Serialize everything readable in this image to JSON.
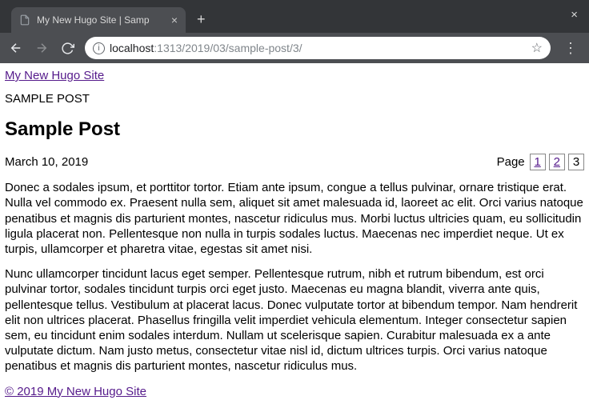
{
  "browser": {
    "tab_title": "My New Hugo Site | Samp",
    "url_host": "localhost",
    "url_rest": ":1313/2019/03/sample-post/3/"
  },
  "site": {
    "title_link": "My New Hugo Site",
    "breadcrumb": "SAMPLE POST"
  },
  "post": {
    "title": "Sample Post",
    "date": "March 10, 2019",
    "pagination": {
      "label": "Page",
      "pages": [
        {
          "n": "1",
          "current": false
        },
        {
          "n": "2",
          "current": false
        },
        {
          "n": "3",
          "current": true
        }
      ]
    },
    "paragraphs": [
      "Donec a sodales ipsum, et porttitor tortor. Etiam ante ipsum, congue a tellus pulvinar, ornare tristique erat. Nulla vel commodo ex. Praesent nulla sem, aliquet sit amet malesuada id, laoreet ac elit. Orci varius natoque penatibus et magnis dis parturient montes, nascetur ridiculus mus. Morbi luctus ultricies quam, eu sollicitudin ligula placerat non. Pellentesque non nulla in turpis sodales luctus. Maecenas nec imperdiet neque. Ut ex turpis, ullamcorper et pharetra vitae, egestas sit amet nisi.",
      "Nunc ullamcorper tincidunt lacus eget semper. Pellentesque rutrum, nibh et rutrum bibendum, est orci pulvinar tortor, sodales tincidunt turpis orci eget justo. Maecenas eu magna blandit, viverra ante quis, pellentesque tellus. Vestibulum at placerat lacus. Donec vulputate tortor at bibendum tempor. Nam hendrerit elit non ultrices placerat. Phasellus fringilla velit imperdiet vehicula elementum. Integer consectetur sapien sem, eu tincidunt enim sodales interdum. Nullam ut scelerisque sapien. Curabitur malesuada ex a ante vulputate dictum. Nam justo metus, consectetur vitae nisl id, dictum ultrices turpis. Orci varius natoque penatibus et magnis dis parturient montes, nascetur ridiculus mus."
    ]
  },
  "footer": {
    "copyright": "© 2019 My New Hugo Site"
  }
}
